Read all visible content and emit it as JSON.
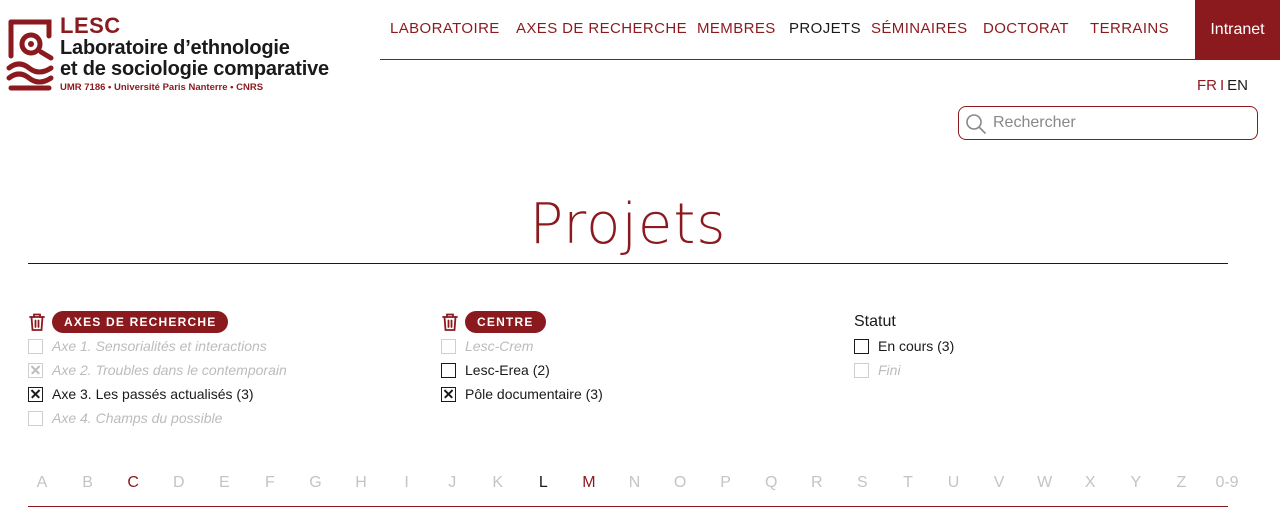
{
  "brand": {
    "acronym": "LESC",
    "name_line1": "Laboratoire d’ethnologie",
    "name_line2": "et de sociologie comparative",
    "subline": "UMR 7186 • Université Paris Nanterre • CNRS",
    "color": "#8b1a1e"
  },
  "nav": {
    "items": [
      {
        "label": "LABORATOIRE"
      },
      {
        "label": "AXES DE RECHERCHE"
      },
      {
        "label": "MEMBRES"
      },
      {
        "label": "PROJETS",
        "active": true
      },
      {
        "label": "SÉMINAIRES"
      },
      {
        "label": "DOCTORAT"
      },
      {
        "label": "TERRAINS"
      }
    ],
    "intranet": "Intranet"
  },
  "lang": {
    "fr": "FR",
    "sep": "I",
    "en": "EN"
  },
  "search": {
    "placeholder": "Rechercher",
    "icon": "search-icon"
  },
  "page": {
    "title": "Projets"
  },
  "filters": {
    "axes": {
      "label": "AXES DE RECHERCHE",
      "options": [
        {
          "label": "Axe 1. Sensorialités et interactions",
          "checked": false,
          "disabled": true
        },
        {
          "label": "Axe 2. Troubles dans le contemporain",
          "checked": true,
          "disabled": true
        },
        {
          "label": "Axe 3. Les passés actualisés (3)",
          "checked": true,
          "disabled": false
        },
        {
          "label": "Axe 4. Champs du possible",
          "checked": false,
          "disabled": true
        }
      ]
    },
    "centre": {
      "label": "CENTRE",
      "options": [
        {
          "label": "Lesc-Crem",
          "checked": false,
          "disabled": true
        },
        {
          "label": "Lesc-Erea (2)",
          "checked": false,
          "disabled": false
        },
        {
          "label": "Pôle documentaire (3)",
          "checked": true,
          "disabled": false
        }
      ]
    },
    "statut": {
      "label": "Statut",
      "options": [
        {
          "label": "En cours (3)",
          "checked": false,
          "disabled": false
        },
        {
          "label": "Fini",
          "checked": false,
          "disabled": true
        }
      ]
    }
  },
  "alphabet": {
    "letters": [
      "A",
      "B",
      "C",
      "D",
      "E",
      "F",
      "G",
      "H",
      "I",
      "J",
      "K",
      "L",
      "M",
      "N",
      "O",
      "P",
      "Q",
      "R",
      "S",
      "T",
      "U",
      "V",
      "W",
      "X",
      "Y",
      "Z",
      "0-9"
    ],
    "available_red": [
      "C",
      "M"
    ],
    "available_dark": [
      "L"
    ]
  }
}
